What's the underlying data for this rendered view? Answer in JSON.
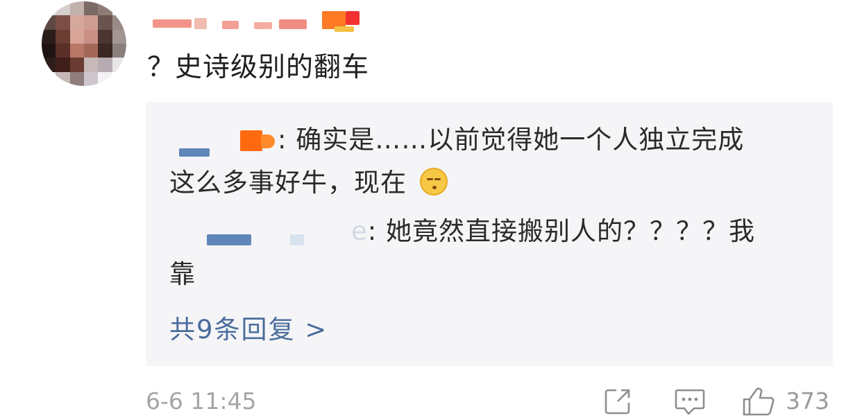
{
  "comment": {
    "text": "？史诗级别的翻车",
    "timestamp": "6-6 11:45",
    "like_count": "373",
    "icons": {
      "share": "share-external-icon",
      "comment": "comment-bubble-icon",
      "like": "thumbs-up-icon"
    }
  },
  "replies": [
    {
      "text_line1": ": 确实是……以前觉得她一个人独立完成",
      "text_line2": "这么多事好牛，现在",
      "emoji": "awkward-smile-emoji"
    },
    {
      "name_tail": "e",
      "text_line1": ": 她竟然直接搬别人的？？？？我",
      "text_line2": "靠"
    }
  ],
  "more_replies_label": "共9条回复 >",
  "colors": {
    "link": "#4a6c9c",
    "panel_bg": "#f5f5f7",
    "muted": "#a5a5a5"
  }
}
